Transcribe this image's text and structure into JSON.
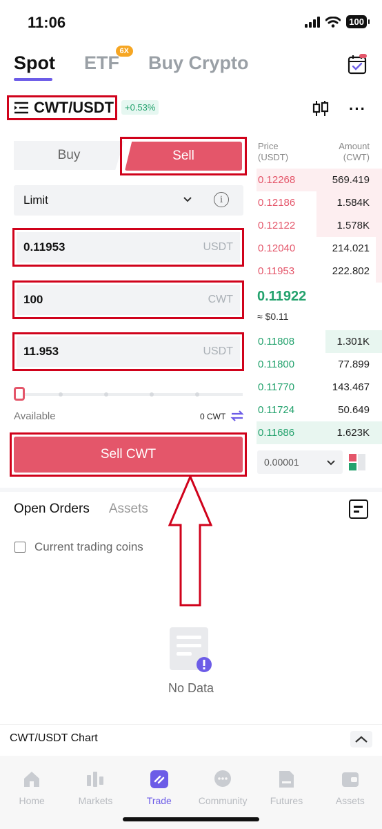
{
  "status_bar": {
    "time": "11:06",
    "battery": "100"
  },
  "top_tabs": [
    {
      "label": "Spot",
      "active": true
    },
    {
      "label": "ETF",
      "badge": "6X",
      "active": false
    },
    {
      "label": "Buy Crypto",
      "active": false
    }
  ],
  "pair": {
    "name": "CWT/USDT",
    "change": "+0.53%"
  },
  "trade": {
    "buy_label": "Buy",
    "sell_label": "Sell",
    "order_type": "Limit",
    "price": {
      "value": "0.11953",
      "unit": "USDT"
    },
    "amount": {
      "value": "100",
      "unit": "CWT"
    },
    "total": {
      "value": "11.953",
      "unit": "USDT"
    },
    "slider_percent": 0,
    "available_label": "Available",
    "available_value": "0 CWT",
    "submit_label": "Sell CWT"
  },
  "order_book": {
    "price_header": [
      "Price",
      "(USDT)"
    ],
    "amount_header": [
      "Amount",
      "(CWT)"
    ],
    "asks": [
      {
        "price": "0.12268",
        "amount": "569.419",
        "depth": 1.0
      },
      {
        "price": "0.12186",
        "amount": "1.584K",
        "depth": 0.52
      },
      {
        "price": "0.12122",
        "amount": "1.578K",
        "depth": 0.52
      },
      {
        "price": "0.12040",
        "amount": "214.021",
        "depth": 0.05
      },
      {
        "price": "0.11953",
        "amount": "222.802",
        "depth": 0.05
      }
    ],
    "last_price": "0.11922",
    "last_fiat": "≈ $0.11",
    "bids": [
      {
        "price": "0.11808",
        "amount": "1.301K",
        "depth": 0.45
      },
      {
        "price": "0.11800",
        "amount": "77.899",
        "depth": 0.0
      },
      {
        "price": "0.11770",
        "amount": "143.467",
        "depth": 0.0
      },
      {
        "price": "0.11724",
        "amount": "50.649",
        "depth": 0.0
      },
      {
        "price": "0.11686",
        "amount": "1.623K",
        "depth": 1.0
      }
    ],
    "precision": "0.00001"
  },
  "orders": {
    "tabs": [
      "Open Orders",
      "Assets"
    ],
    "filter_label": "Current trading coins",
    "empty_text": "No Data"
  },
  "chart_bar": {
    "label": "CWT/USDT Chart"
  },
  "bottom_nav": [
    {
      "label": "Home",
      "icon": "home-icon",
      "active": false
    },
    {
      "label": "Markets",
      "icon": "markets-icon",
      "active": false
    },
    {
      "label": "Trade",
      "icon": "trade-icon",
      "active": true
    },
    {
      "label": "Community",
      "icon": "community-icon",
      "active": false
    },
    {
      "label": "Futures",
      "icon": "futures-icon",
      "active": false
    },
    {
      "label": "Assets",
      "icon": "wallet-icon",
      "active": false
    }
  ],
  "colors": {
    "accent": "#6c5ce7",
    "sell": "#e4566a",
    "buy": "#23a26d",
    "annotation": "#d0021b"
  }
}
